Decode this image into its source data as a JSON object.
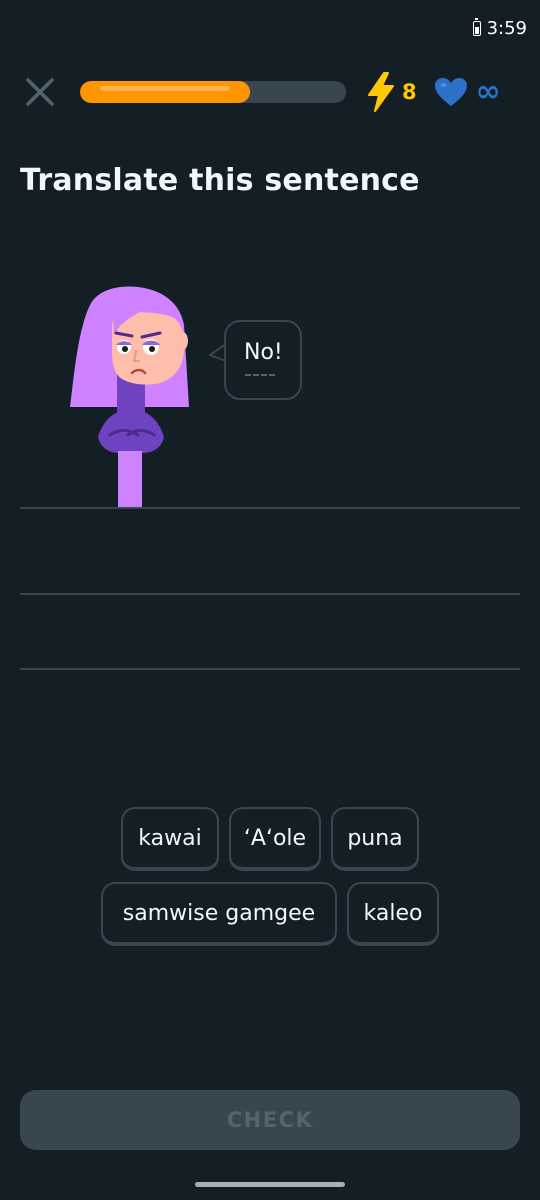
{
  "status_bar": {
    "time": "3:59",
    "battery_icon": "battery-icon"
  },
  "top_bar": {
    "close_icon": "close-icon",
    "progress_fraction": 0.64,
    "energy_icon": "lightning-icon",
    "energy_count": "8",
    "hearts_icon": "heart-icon",
    "hearts_value": "∞"
  },
  "exercise": {
    "title": "Translate this sentence",
    "prompt_text": "No!"
  },
  "word_bank": {
    "rows": [
      [
        "kawai",
        "ʻAʻole",
        "puna"
      ],
      [
        "samwise gamgee",
        "kaleo"
      ]
    ]
  },
  "check_label": "CHECK",
  "colors": {
    "background": "#131f24",
    "accent_orange": "#ff9600",
    "energy_yellow": "#ffc800",
    "heart_blue": "#2b70c9",
    "border": "#37464f"
  }
}
